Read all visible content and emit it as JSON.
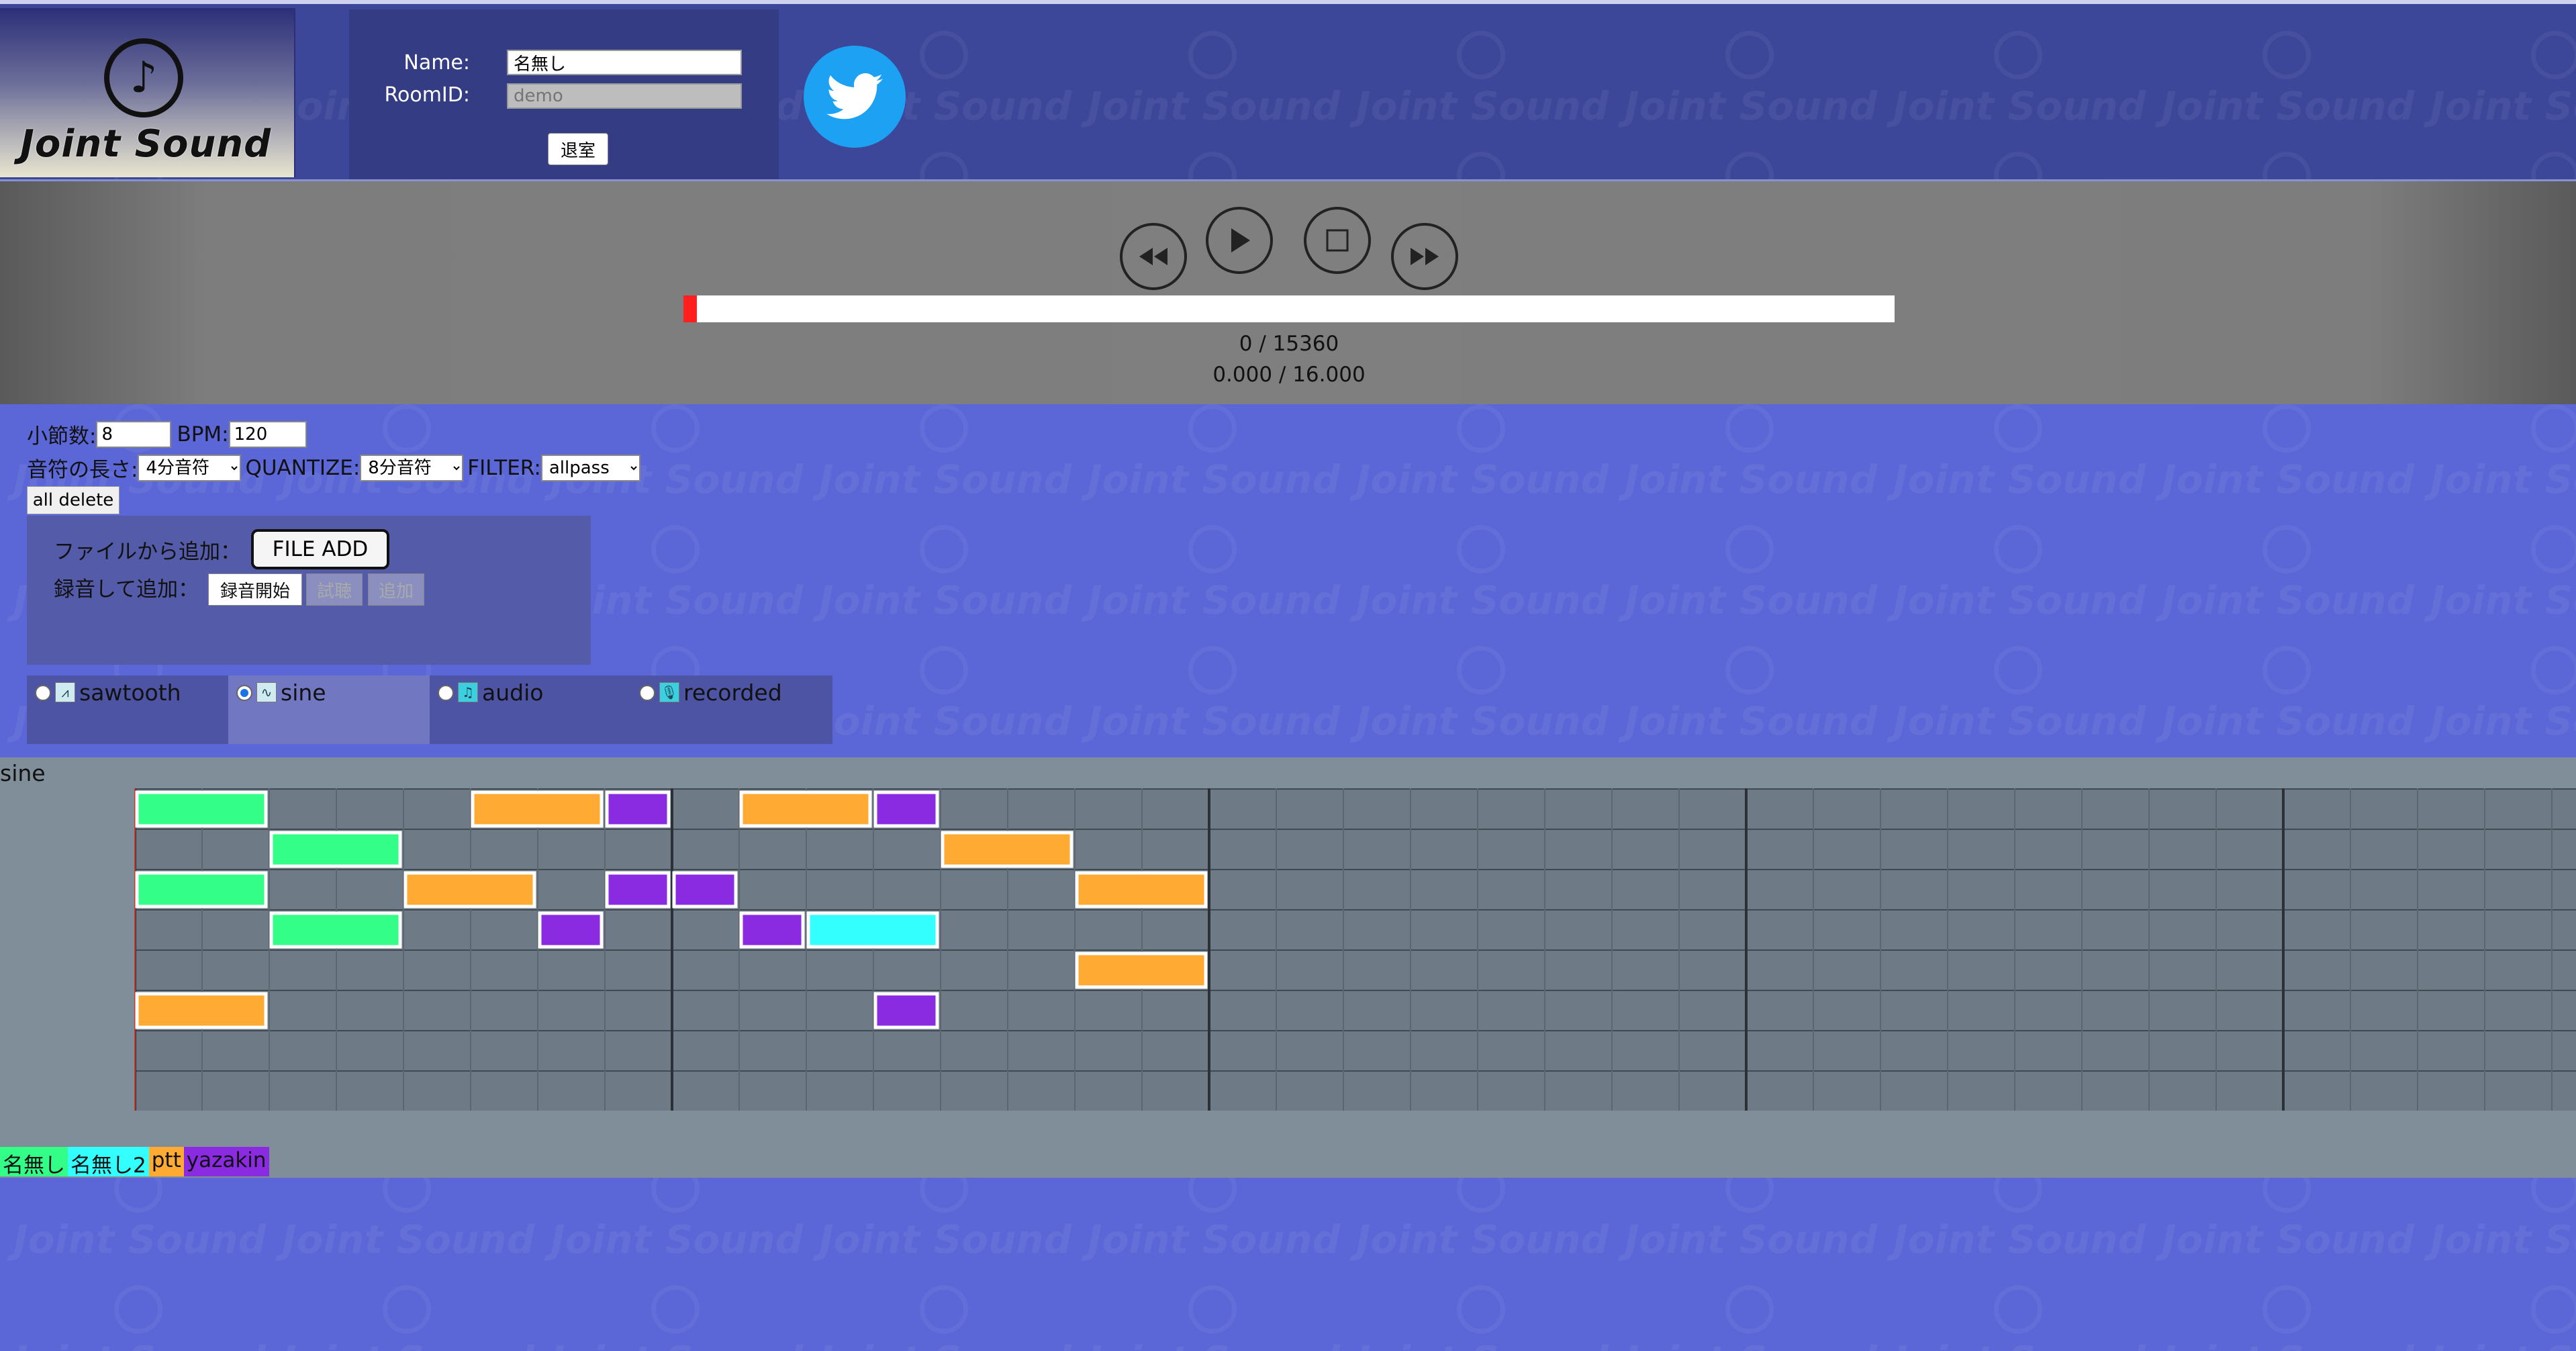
{
  "header": {
    "logo_text": "Joint Sound",
    "name_label": "Name:",
    "name_value": "名無し",
    "room_label": "RoomID:",
    "room_placeholder": "demo",
    "leave_label": "退室",
    "twitter_icon": "twitter-bird-icon",
    "watermark_text": "Joint Sound"
  },
  "transport": {
    "rewind_icon": "rewind-icon",
    "play_icon": "play-icon",
    "stop_icon": "stop-icon",
    "forward_icon": "fast-forward-icon",
    "progress_fraction": 0.0,
    "progress_color": "#ff1f1f",
    "tick_counter": "0 / 15360",
    "time_counter": "0.000 / 16.000"
  },
  "controls": {
    "measures_label": "小節数:",
    "measures_value": "8",
    "bpm_label": "BPM:",
    "bpm_value": "120",
    "note_length_label": "音符の長さ:",
    "note_length_value": "4分音符",
    "quantize_label": "QUANTIZE:",
    "quantize_value": "8分音符",
    "filter_label": "FILTER:",
    "filter_value": "allpass",
    "all_delete_label": "all delete",
    "file_add_label": "ファイルから追加：",
    "file_add_button": "FILE ADD",
    "record_add_label": "録音して追加：",
    "record_start": "録音開始",
    "preview": "試聴",
    "add": "追加"
  },
  "tabs": [
    {
      "label": "sawtooth",
      "icon": "sawtooth-wave-icon",
      "selected": false
    },
    {
      "label": "sine",
      "icon": "sine-wave-icon",
      "selected": true
    },
    {
      "label": "audio",
      "icon": "audio-file-icon",
      "selected": false
    },
    {
      "label": "recorded",
      "icon": "microphone-icon",
      "selected": false
    }
  ],
  "sequencer": {
    "track_label": "sine",
    "rows": 8,
    "columns": 38,
    "notes": [
      {
        "row": 0,
        "col": 0,
        "len": 2,
        "user": "名無し"
      },
      {
        "row": 0,
        "col": 5,
        "len": 2,
        "user": "ptt"
      },
      {
        "row": 0,
        "col": 7,
        "len": 1,
        "user": "yazakin"
      },
      {
        "row": 0,
        "col": 9,
        "len": 2,
        "user": "ptt"
      },
      {
        "row": 0,
        "col": 11,
        "len": 1,
        "user": "yazakin"
      },
      {
        "row": 1,
        "col": 2,
        "len": 2,
        "user": "名無し"
      },
      {
        "row": 1,
        "col": 12,
        "len": 2,
        "user": "ptt"
      },
      {
        "row": 2,
        "col": 0,
        "len": 2,
        "user": "名無し"
      },
      {
        "row": 2,
        "col": 4,
        "len": 2,
        "user": "ptt"
      },
      {
        "row": 2,
        "col": 7,
        "len": 1,
        "user": "yazakin"
      },
      {
        "row": 2,
        "col": 8,
        "len": 1,
        "user": "yazakin"
      },
      {
        "row": 2,
        "col": 14,
        "len": 2,
        "user": "ptt"
      },
      {
        "row": 3,
        "col": 2,
        "len": 2,
        "user": "名無し"
      },
      {
        "row": 3,
        "col": 6,
        "len": 1,
        "user": "yazakin"
      },
      {
        "row": 3,
        "col": 9,
        "len": 1,
        "user": "yazakin"
      },
      {
        "row": 3,
        "col": 10,
        "len": 2,
        "user": "名無し2"
      },
      {
        "row": 4,
        "col": 14,
        "len": 2,
        "user": "ptt"
      },
      {
        "row": 5,
        "col": 0,
        "len": 2,
        "user": "ptt"
      },
      {
        "row": 5,
        "col": 11,
        "len": 1,
        "user": "yazakin"
      }
    ]
  },
  "users": [
    {
      "name": "名無し",
      "color": "#33ff88"
    },
    {
      "name": "名無し2",
      "color": "#33ffff"
    },
    {
      "name": "ptt",
      "color": "#ffaa33"
    },
    {
      "name": "yazakin",
      "color": "#8a2be2"
    }
  ]
}
